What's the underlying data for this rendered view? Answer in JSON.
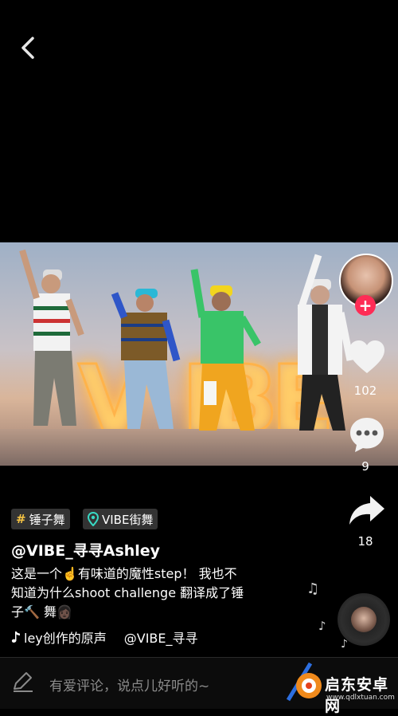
{
  "nav": {
    "back_icon": "chevron-left-icon"
  },
  "video": {
    "sign_letters": [
      "V",
      "I",
      "B",
      "E"
    ]
  },
  "actions": {
    "like_count": "102",
    "comment_count": "9",
    "share_count": "18"
  },
  "tags": [
    {
      "icon": "#",
      "label": "锤子舞"
    },
    {
      "icon": "location-pin-icon",
      "label": "VIBE街舞"
    }
  ],
  "author": {
    "username": "@VIBE_寻寻Ashley"
  },
  "caption": {
    "line1": "这是一个☝️有味道的魔性step！ 我也不",
    "line2": "知道为什么shoot challenge 翻译成了锤",
    "line3": "子🔨 舞👩🏿"
  },
  "music": {
    "title": "ley创作的原声",
    "author": "@VIBE_寻寻"
  },
  "comment": {
    "placeholder": "有爱评论，说点儿好听的~"
  },
  "watermark": {
    "text": "启东安卓网",
    "url": "www.qdlxtuan.com"
  },
  "colors": {
    "accent": "#fe2c55",
    "tag_hash": "#f5c343",
    "location": "#38d9c4"
  }
}
